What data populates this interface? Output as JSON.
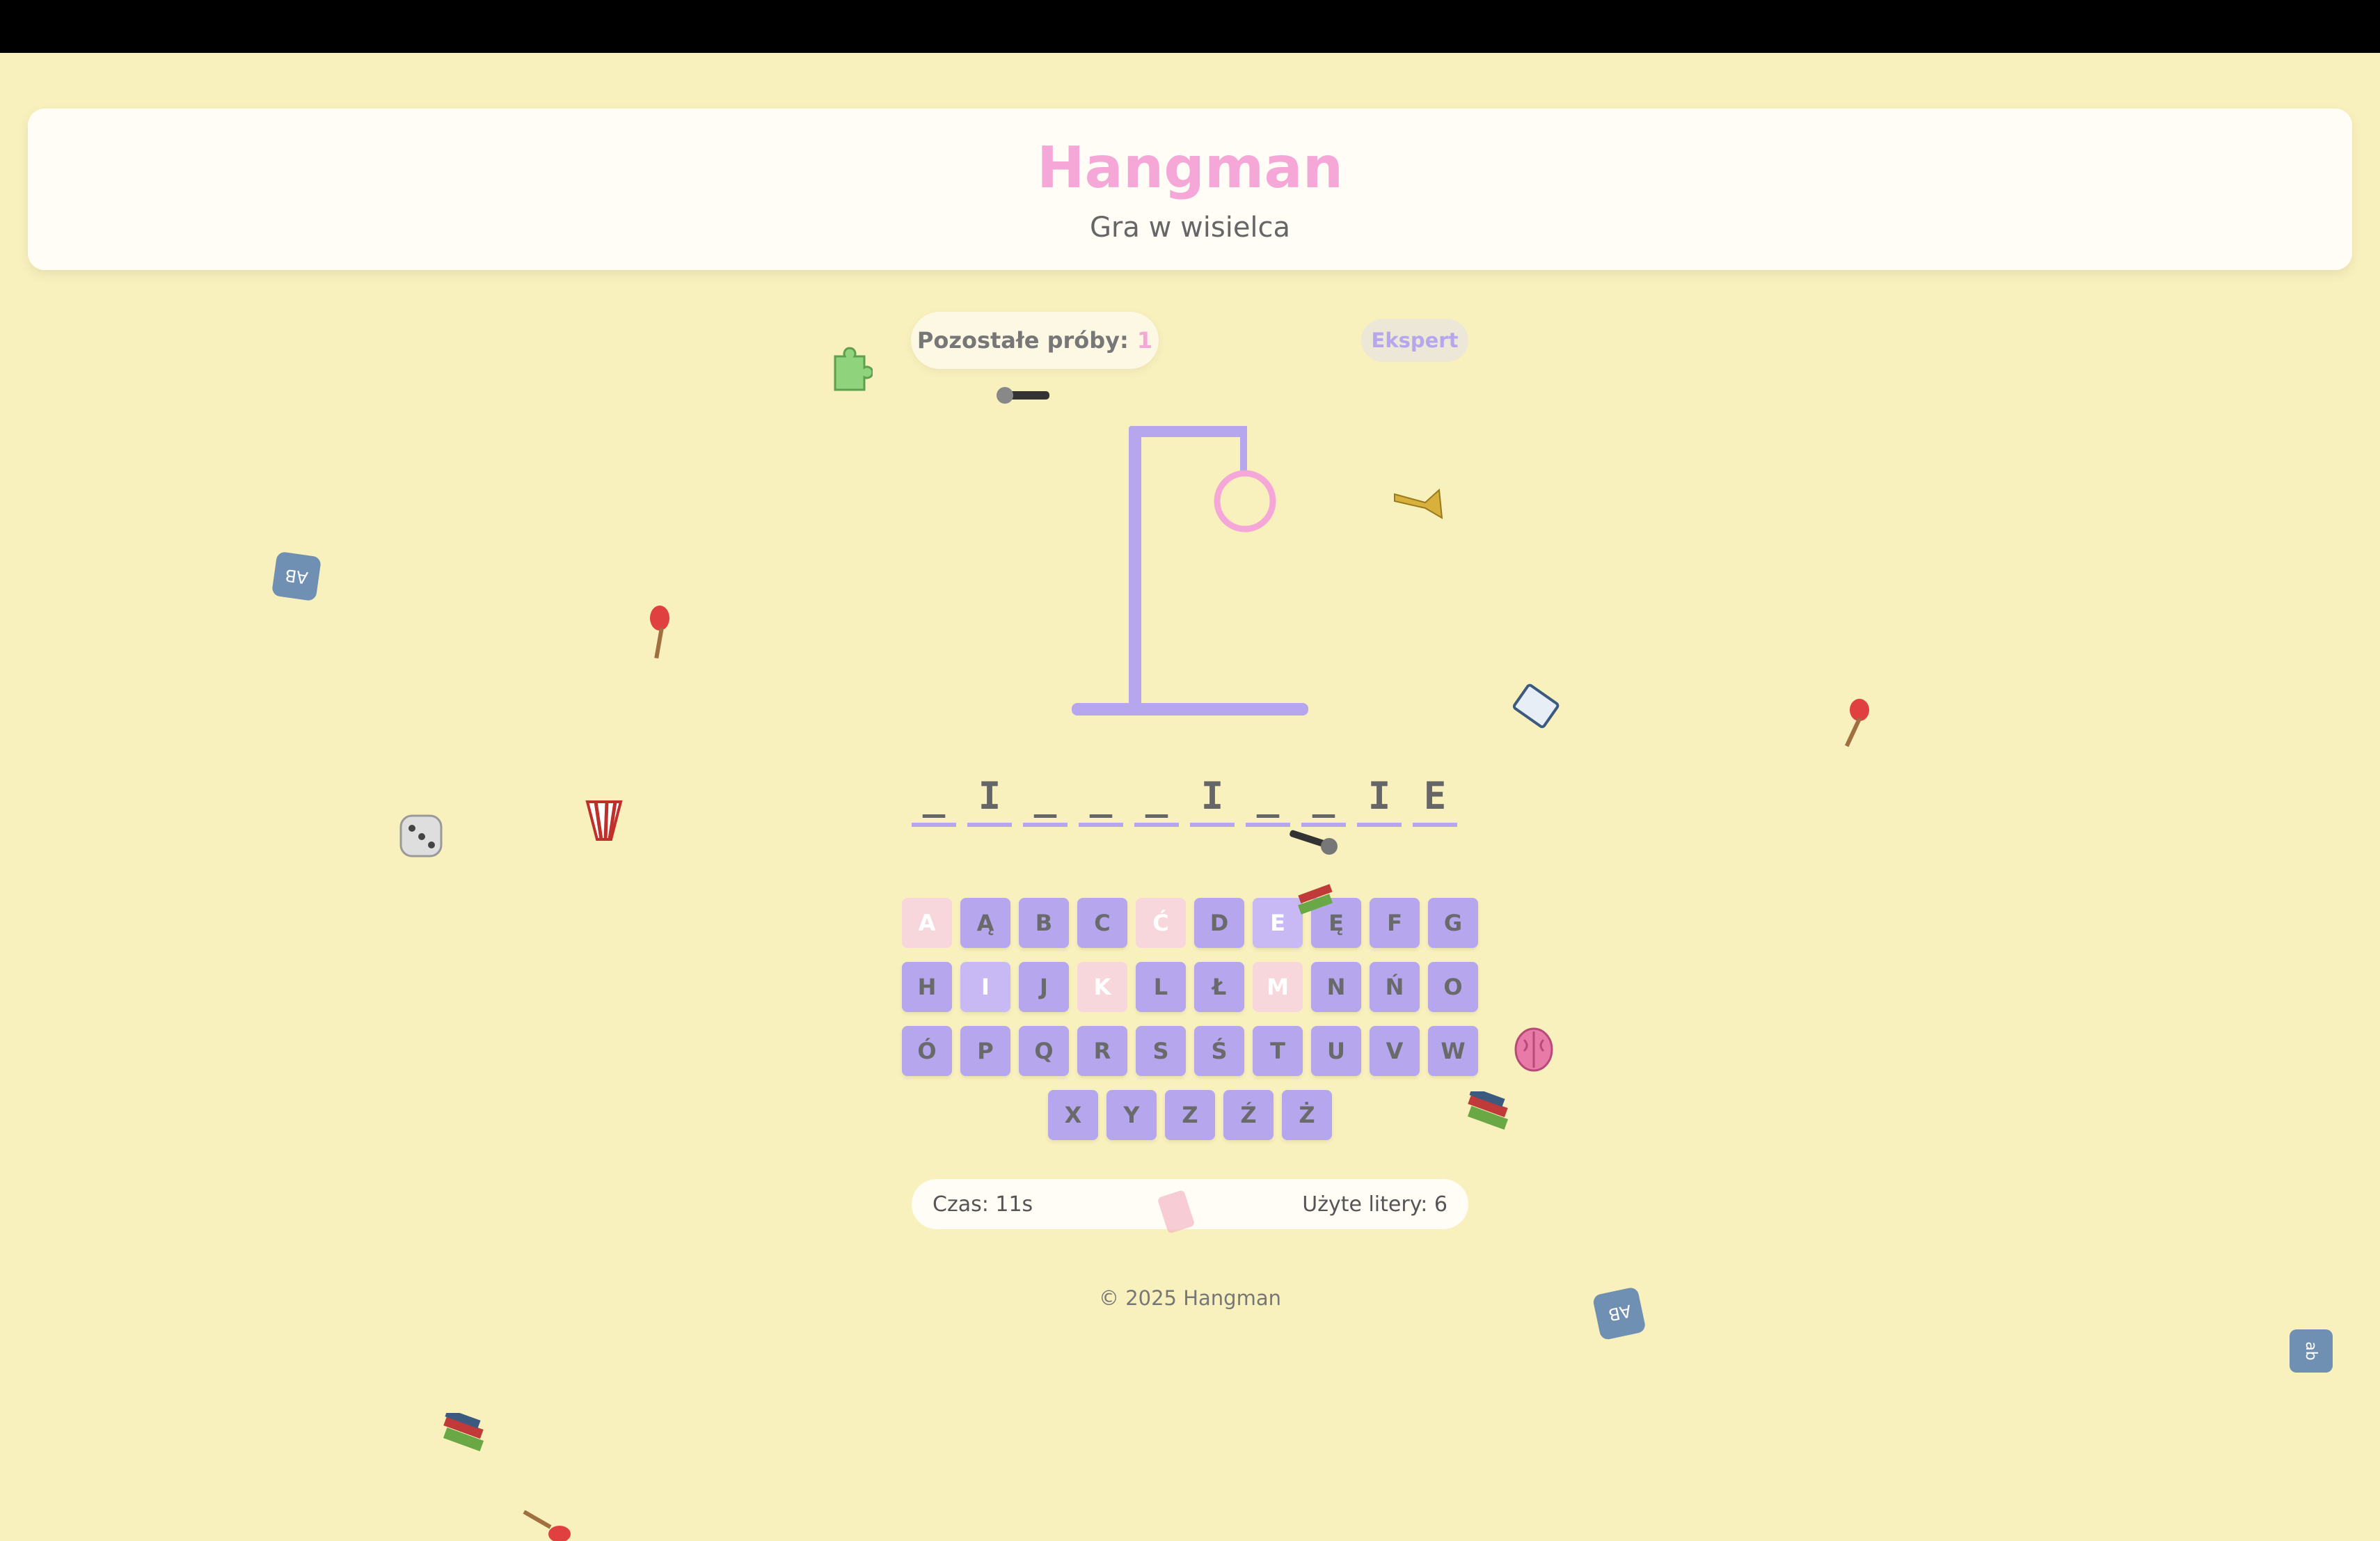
{
  "header": {
    "title": "Hangman",
    "subtitle": "Gra w wisielca"
  },
  "status": {
    "attempts_label": "Pozostałe próby:",
    "attempts_value": "1",
    "level": "Ekspert"
  },
  "word": {
    "letters": [
      "_",
      "I",
      "_",
      "_",
      "_",
      "I",
      "_",
      "_",
      "I",
      "E"
    ]
  },
  "keyboard": {
    "rows": [
      [
        {
          "k": "A",
          "s": "wrong"
        },
        {
          "k": "Ą",
          "s": "normal"
        },
        {
          "k": "B",
          "s": "normal"
        },
        {
          "k": "C",
          "s": "normal"
        },
        {
          "k": "Ć",
          "s": "wrong"
        },
        {
          "k": "D",
          "s": "normal"
        },
        {
          "k": "E",
          "s": "correct"
        },
        {
          "k": "Ę",
          "s": "normal"
        },
        {
          "k": "F",
          "s": "normal"
        },
        {
          "k": "G",
          "s": "normal"
        }
      ],
      [
        {
          "k": "H",
          "s": "normal"
        },
        {
          "k": "I",
          "s": "correct"
        },
        {
          "k": "J",
          "s": "normal"
        },
        {
          "k": "K",
          "s": "wrong"
        },
        {
          "k": "L",
          "s": "normal"
        },
        {
          "k": "Ł",
          "s": "normal"
        },
        {
          "k": "M",
          "s": "wrong"
        },
        {
          "k": "N",
          "s": "normal"
        },
        {
          "k": "Ń",
          "s": "normal"
        },
        {
          "k": "O",
          "s": "normal"
        }
      ],
      [
        {
          "k": "Ó",
          "s": "normal"
        },
        {
          "k": "P",
          "s": "normal"
        },
        {
          "k": "Q",
          "s": "normal"
        },
        {
          "k": "R",
          "s": "normal"
        },
        {
          "k": "S",
          "s": "normal"
        },
        {
          "k": "Ś",
          "s": "normal"
        },
        {
          "k": "T",
          "s": "normal"
        },
        {
          "k": "U",
          "s": "normal"
        },
        {
          "k": "V",
          "s": "normal"
        },
        {
          "k": "W",
          "s": "normal"
        }
      ],
      [
        {
          "k": "X",
          "s": "normal"
        },
        {
          "k": "Y",
          "s": "normal"
        },
        {
          "k": "Z",
          "s": "normal"
        },
        {
          "k": "Ź",
          "s": "normal"
        },
        {
          "k": "Ż",
          "s": "normal"
        }
      ]
    ]
  },
  "stats": {
    "time": "Czas: 11s",
    "used_letters": "Użyte litery: 6"
  },
  "footer": {
    "copyright": "© 2025 Hangman"
  },
  "colors": {
    "background": "#f9f1bd",
    "accent_pink": "#f5a8d8",
    "accent_lavender": "#b5a6ee",
    "wrong_key": "#f8d7dc"
  },
  "decorations": [
    "puzzle-piece-icon",
    "microphone-icon",
    "trumpet-icon",
    "abc-block-icon",
    "guitar-icon",
    "book-icon",
    "dice-icon",
    "popcorn-icon",
    "brain-icon",
    "books-icon"
  ]
}
